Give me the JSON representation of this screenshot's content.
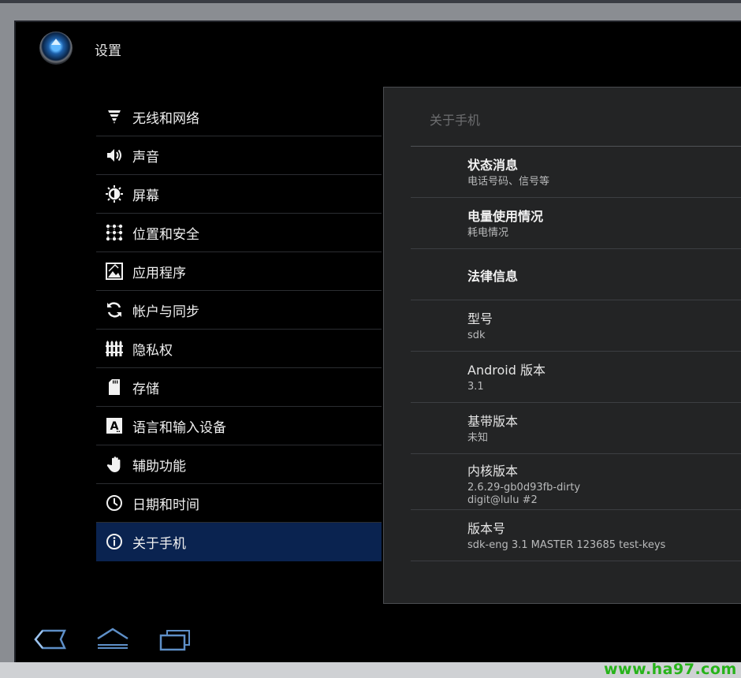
{
  "header": {
    "title": "设置",
    "app_icon": "settings-app-icon"
  },
  "menu": {
    "items": [
      {
        "label": "无线和网络",
        "icon": "wireless-icon"
      },
      {
        "label": "声音",
        "icon": "speaker-icon"
      },
      {
        "label": "屏幕",
        "icon": "brightness-icon"
      },
      {
        "label": "位置和安全",
        "icon": "location-security-icon"
      },
      {
        "label": "应用程序",
        "icon": "applications-icon"
      },
      {
        "label": "帐户与同步",
        "icon": "sync-icon"
      },
      {
        "label": "隐私权",
        "icon": "privacy-icon"
      },
      {
        "label": "存储",
        "icon": "sd-card-icon"
      },
      {
        "label": "语言和输入设备",
        "icon": "language-icon"
      },
      {
        "label": "辅助功能",
        "icon": "hand-icon"
      },
      {
        "label": "日期和时间",
        "icon": "clock-icon"
      },
      {
        "label": "关于手机",
        "icon": "info-icon",
        "selected": true
      }
    ]
  },
  "detail": {
    "title": "关于手机",
    "items": [
      {
        "title": "状态消息",
        "summary": "电话号码、信号等"
      },
      {
        "title": "电量使用情况",
        "summary": "耗电情况"
      },
      {
        "title": "法律信息"
      },
      {
        "title": "型号",
        "summary": "sdk"
      },
      {
        "title": "Android 版本",
        "summary": "3.1"
      },
      {
        "title": "基带版本",
        "summary": "未知"
      },
      {
        "title": "内核版本",
        "summary": "2.6.29-gb0d93fb-dirty",
        "summary2": "digit@lulu #2"
      },
      {
        "title": "版本号",
        "summary": "sdk-eng 3.1 MASTER 123685 test-keys"
      }
    ]
  },
  "navbar": {
    "back_icon": "back-icon",
    "home_icon": "home-icon",
    "recents_icon": "recent-apps-icon"
  },
  "watermark": "www.ha97.com",
  "colors": {
    "selected_bg": "#0a2350",
    "pane_bg": "#232425",
    "watermark": "#27b31a"
  }
}
